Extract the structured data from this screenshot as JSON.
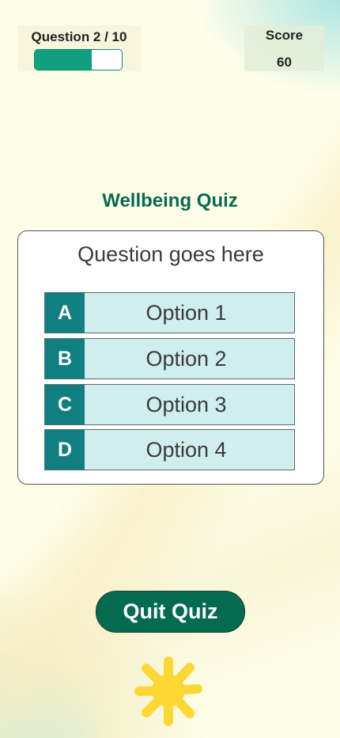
{
  "progress": {
    "label": "Question 2 / 10",
    "fraction": 0.65
  },
  "score": {
    "label": "Score",
    "value": "60"
  },
  "quiz": {
    "title": "Wellbeing Quiz",
    "question": "Question goes here",
    "options": [
      {
        "letter": "A",
        "text": "Option 1"
      },
      {
        "letter": "B",
        "text": "Option 2"
      },
      {
        "letter": "C",
        "text": "Option 3"
      },
      {
        "letter": "D",
        "text": "Option 4"
      }
    ]
  },
  "actions": {
    "quit_label": "Quit Quiz"
  },
  "decoration": {
    "icon": "sun-icon",
    "sun_color": "#fdd835"
  },
  "colors": {
    "accent": "#076b4d",
    "progress_fill": "#11a07f",
    "option_letter_bg": "#0f7f7f",
    "option_bg": "#cfeeed"
  }
}
